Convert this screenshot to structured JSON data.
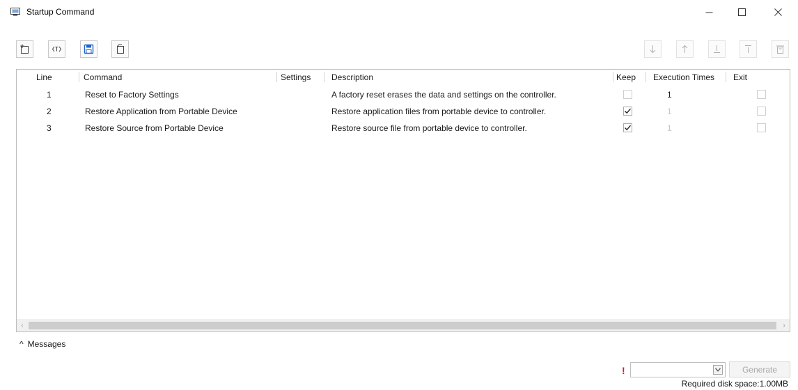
{
  "window": {
    "title": "Startup Command",
    "minimize_glyph": "—",
    "maximize_glyph": "☐",
    "close_glyph": "✕"
  },
  "toolbar": {
    "left_buttons": [
      "add-command-icon",
      "parameter-icon",
      "save-icon",
      "import-icon"
    ],
    "right_buttons": [
      "move-down-icon",
      "move-up-icon",
      "move-to-bottom-icon",
      "move-to-top-icon",
      "delete-icon"
    ]
  },
  "grid": {
    "columns": [
      "Line",
      "Command",
      "Settings",
      "Description",
      "Keep",
      "Execution Times",
      "Exit"
    ],
    "rows": [
      {
        "line": "1",
        "command": "Reset to Factory Settings",
        "settings": "",
        "description": "A factory reset erases the data and settings on the controller.",
        "keep": false,
        "execution_times": "1",
        "exec_enabled": true,
        "exit": false
      },
      {
        "line": "2",
        "command": "Restore Application from Portable Device",
        "settings": "",
        "description": "Restore application files from portable device to controller.",
        "keep": true,
        "execution_times": "1",
        "exec_enabled": false,
        "exit": false
      },
      {
        "line": "3",
        "command": "Restore Source from Portable Device",
        "settings": "",
        "description": "Restore source file from portable device to controller.",
        "keep": true,
        "execution_times": "1",
        "exec_enabled": false,
        "exit": false
      }
    ]
  },
  "messages": {
    "toggle_glyph": "^",
    "label": "Messages"
  },
  "footer": {
    "warning_glyph": "!",
    "select_value": "",
    "generate_label": "Generate",
    "disk_space": "Required disk space:1.00MB"
  },
  "colors": {
    "accent": "#1e64c8",
    "warning": "#d8182a",
    "disabled_text": "#a8a8a8"
  }
}
